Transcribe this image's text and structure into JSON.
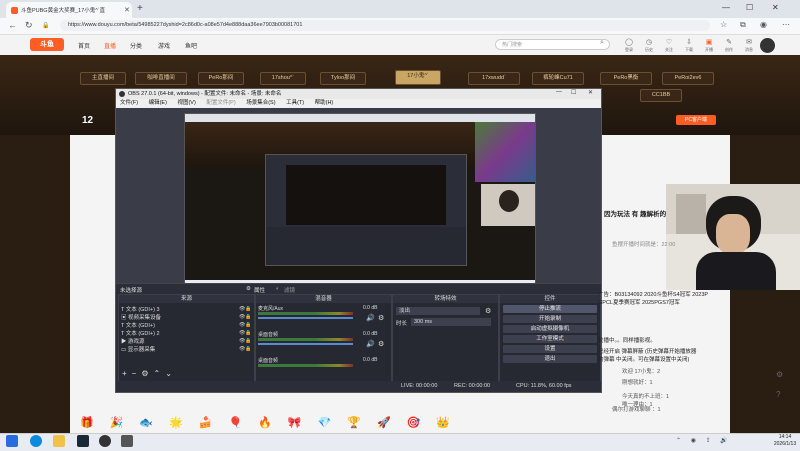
{
  "browser": {
    "tab_title": "斗鱼PUBG黄金大奖赛_17小鬼^`直",
    "url": "https://www.douyu.com/beta/54985227dyshid=2c86d0c-a08e57d4e888daa36ee7903b00081701"
  },
  "douyu": {
    "nav": [
      "首页",
      "直播",
      "分类",
      "游戏",
      "鱼吧"
    ],
    "search_placeholder": "热门搜索",
    "header_icons": [
      "登录",
      "历史",
      "关注",
      "下载",
      "开播",
      "创作",
      "消息"
    ],
    "room_tabs": [
      "主直播间",
      "咖啡直播间",
      "PeRo那间",
      "17shou^`",
      "Tyloo那间",
      "17小鬼^`",
      "17xwudd`",
      "裤轮峰Cu71",
      "PeRo黑衡",
      "PeRoi2ev6"
    ],
    "room_tabs_row2": [
      "CC1BB"
    ],
    "room_number": "12",
    "gift_label": "PC客户端"
  },
  "obs": {
    "title": "OBS 27.0.1 (64-bit, windows) - 配置文件: 未命名 - 场景: 未命名",
    "menu": [
      "文件(F)",
      "编辑(E)",
      "视图(V)",
      "配置文件(P)",
      "场景集合(S)",
      "工具(T)",
      "帮助(H)"
    ],
    "no_source_selected": "未选择源",
    "properties": "属性",
    "filters": "滤镜",
    "docks": {
      "sources_title": "来源",
      "mixer_title": "混音器",
      "transitions_title": "转场特效",
      "controls_title": "控件"
    },
    "sources": [
      "文本 (GDI+) 3",
      "视频采集设备",
      "文本 (GDI+)",
      "文本 (GDI+) 2",
      "游戏源",
      "显示器采集"
    ],
    "mixer": [
      {
        "name": "麦克风/Aux",
        "db": "0.0 dB"
      },
      {
        "name": "桌面音频",
        "db": "0.0 dB"
      },
      {
        "name": "桌面音频",
        "db": "0.0 dB"
      }
    ],
    "transition": {
      "type": "淡出",
      "duration_label": "时长",
      "duration": "300 ms"
    },
    "controls": [
      "停止推流",
      "开始录制",
      "启动虚拟摄像机",
      "工作室模式",
      "设置",
      "退出"
    ],
    "status": {
      "live": "LIVE: 00:00:00",
      "rec": "REC: 00:00:00",
      "cpu": "CPU: 11.8%, 60.00 fps"
    }
  },
  "chat": [
    {
      "text": "因为玩法 有 趣解析的"
    },
    {
      "text": "鱼摆开播时间就是：22:00"
    },
    {
      "text": "广告：B03134092 2020斗鱼杯S4冠军 2023P"
    },
    {
      "text": "GPCL夏季赛冠军 2025PGS7冠军"
    },
    {
      "text": "轮播中。。同样播影视。"
    },
    {
      "text": "已经开启 弹幕屏蔽 (历史弹幕开始播放器"
    },
    {
      "text": "的弹幕 中关闭。可在弹幕设置中关闭)"
    },
    {
      "text": "欢迎 17小鬼：2"
    },
    {
      "text": "刚想就好：1"
    },
    {
      "text": "今天真的不上班：1"
    },
    {
      "text": "唯一理由：1"
    },
    {
      "text": "偶尔打游戏聊聊 ：1"
    }
  ],
  "taskbar": {
    "time": "14:14",
    "date": "2026/1/13"
  }
}
